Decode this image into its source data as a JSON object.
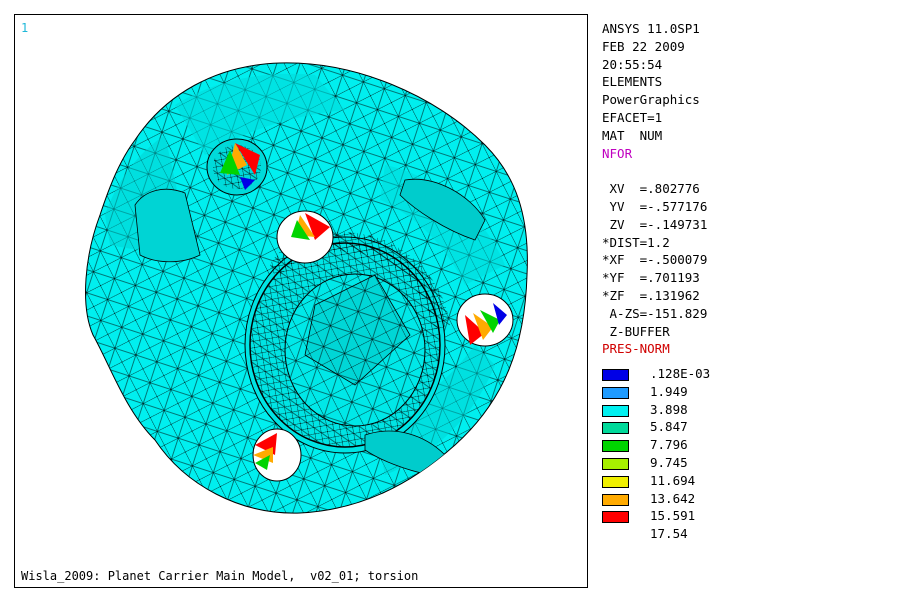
{
  "viewport": {
    "window_number": "1",
    "caption": "Wisla_2009: Planet Carrier Main Model,  v02_01; torsion"
  },
  "info": {
    "lines": [
      "ANSYS 11.0SP1",
      "FEB 22 2009",
      "20:55:54",
      "ELEMENTS",
      "PowerGraphics",
      "EFACET=1",
      "MAT  NUM"
    ],
    "nfor": "NFOR",
    "view_lines": [
      " XV  =.802776",
      " YV  =-.577176",
      " ZV  =-.149731",
      "*DIST=1.2",
      "*XF  =-.500079",
      "*YF  =.701193",
      "*ZF  =.131962",
      " A-ZS=-151.829",
      " Z-BUFFER"
    ],
    "pres_norm": "PRES-NORM"
  },
  "legend": {
    "labels": [
      ".128E-03",
      "1.949",
      "3.898",
      "5.847",
      "7.796",
      "9.745",
      "11.694",
      "13.642",
      "15.591"
    ],
    "max_label": "17.54",
    "colors": [
      "#0000e6",
      "#1e9bff",
      "#00f0f0",
      "#00d99a",
      "#00d400",
      "#a6f000",
      "#f0f000",
      "#ffaa00",
      "#ff0000"
    ]
  },
  "model": {
    "fill_color": "#00efef",
    "mesh_color": "#000000"
  }
}
